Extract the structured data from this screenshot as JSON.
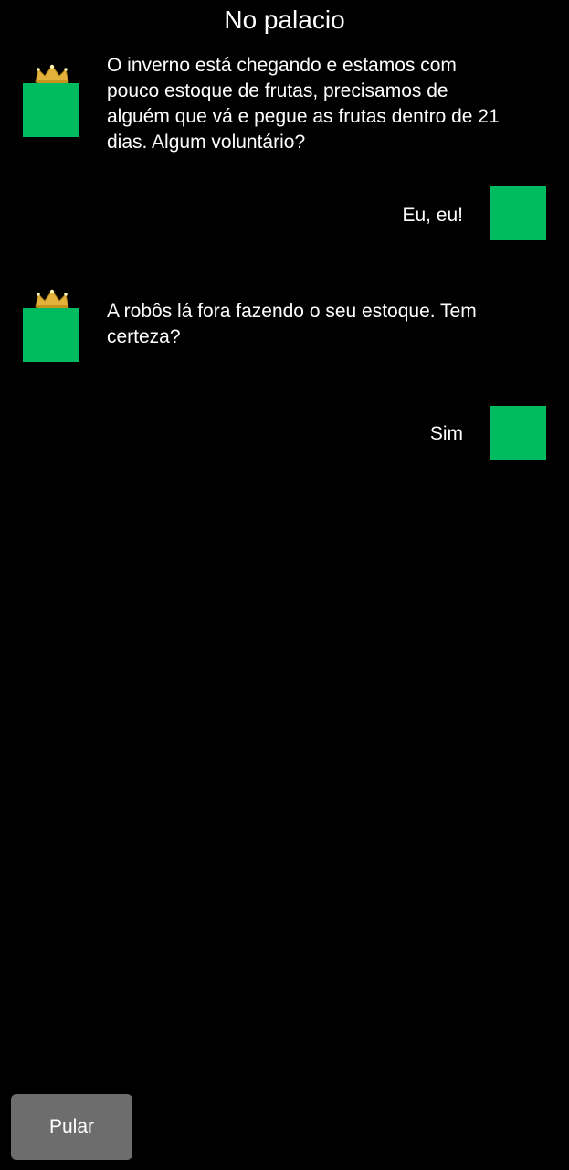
{
  "header": {
    "title": "No palacio"
  },
  "messages": [
    {
      "speaker": "king",
      "text": "O inverno está chegando e estamos com pouco estoque de frutas, precisamos de alguém que vá e pegue as frutas dentro de 21 dias. Algum voluntário?"
    },
    {
      "speaker": "player",
      "text": "Eu, eu!"
    },
    {
      "speaker": "king",
      "text": "A robôs lá fora fazendo o seu estoque. Tem certeza?"
    },
    {
      "speaker": "player",
      "text": "Sim"
    }
  ],
  "controls": {
    "skip_label": "Pular"
  },
  "colors": {
    "background": "#000000",
    "avatar": "#00bb5f",
    "button": "#6d6d6d",
    "crown": "#e3b23c"
  },
  "icons": {
    "king_badge": "crown-icon"
  }
}
